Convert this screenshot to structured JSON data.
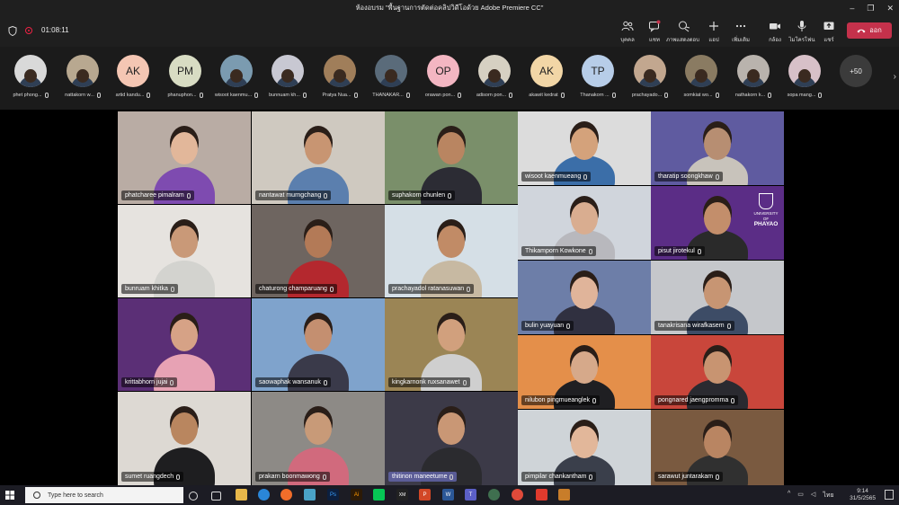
{
  "window": {
    "title": "ห้องอบรม \"พื้นฐานการตัดต่อคลิปวิดีโอด้วย Adobe Premiere CC\"",
    "controls": [
      "–",
      "❐",
      "✕"
    ]
  },
  "toolbar": {
    "timer": "01:08:11",
    "items": [
      {
        "label": "บุคคล",
        "icon": "people-icon"
      },
      {
        "label": "แชท",
        "icon": "chat-icon"
      },
      {
        "label": "ภาพแสดงตอบสนอง",
        "icon": "reactions-icon"
      },
      {
        "label": "แอป",
        "icon": "apps-icon"
      },
      {
        "label": "เพิ่มเติม",
        "icon": "more-icon"
      },
      {
        "label": "กล้อง",
        "icon": "camera-icon"
      },
      {
        "label": "ไมโครโฟน",
        "icon": "microphone-icon"
      },
      {
        "label": "แชร์",
        "icon": "share-icon"
      }
    ],
    "leave_label": "ออก"
  },
  "participants": [
    {
      "name": "phet phong...",
      "initials": "",
      "bg": "#d9d9d9"
    },
    {
      "name": "nattakorn w...",
      "initials": "",
      "bg": "#b8a890"
    },
    {
      "name": "artid kandu...",
      "initials": "AK",
      "bg": "#f4c6b3"
    },
    {
      "name": "phanuphon...",
      "initials": "PM",
      "bg": "#d8dcc3"
    },
    {
      "name": "wisoot kaenmu...",
      "initials": "",
      "bg": "#7b9bb0"
    },
    {
      "name": "bunnuam kh...",
      "initials": "",
      "bg": "#c8c8d2"
    },
    {
      "name": "Pratya Nua...",
      "initials": "",
      "bg": "#a07e5a"
    },
    {
      "name": "THANAKAR...",
      "initials": "",
      "bg": "#5a6b7a"
    },
    {
      "name": "orawan pon...",
      "initials": "OP",
      "bg": "#f3b6c2"
    },
    {
      "name": "adisorn pon...",
      "initials": "",
      "bg": "#d6d0c2"
    },
    {
      "name": "akawit kedrat",
      "initials": "AK",
      "bg": "#f2d6a6"
    },
    {
      "name": "Thanakorn ...",
      "initials": "TP",
      "bg": "#b7cde8"
    },
    {
      "name": "prachayado...",
      "initials": "",
      "bg": "#c2a78f"
    },
    {
      "name": "somkiat wo...",
      "initials": "",
      "bg": "#8a7b62"
    },
    {
      "name": "nathakorn k...",
      "initials": "",
      "bg": "#b9b3ad"
    },
    {
      "name": "sopa mang...",
      "initials": "",
      "bg": "#d7c0c8"
    }
  ],
  "more_count": "+50",
  "tiles": [
    {
      "name": "phatcharee pimalram",
      "bg": "#b9aca4",
      "skin": "#e2b79a",
      "shirt": "#7e4bb0"
    },
    {
      "name": "nantawat murngchang",
      "bg": "#cfc9c0",
      "skin": "#c89572",
      "shirt": "#5b7fae"
    },
    {
      "name": "suphakorn chunlen",
      "bg": "#7a8f6a",
      "skin": "#b98561",
      "shirt": "#2c2c34"
    },
    {
      "name": "wisoot kaenmueang",
      "bg": "#dcdcdc",
      "skin": "#d4a27b",
      "shirt": "#3b6ea8"
    },
    {
      "name": "tharatip soongkhaw",
      "bg": "#5f5ba0",
      "skin": "#b78e72",
      "shirt": "#c8c3bb"
    },
    {
      "name": "bunruam khitka",
      "bg": "#e6e3df",
      "skin": "#c99978",
      "shirt": "#d3d3cf"
    },
    {
      "name": "chaturong champaruang",
      "bg": "#6e6560",
      "skin": "#b37a57",
      "shirt": "#b4282e"
    },
    {
      "name": "prachayadol ratanasuwan",
      "bg": "#d5dfe6",
      "skin": "#c18b66",
      "shirt": "#c7b9a2"
    },
    {
      "name": "Thikamporn Kowkone",
      "bg": "#d0d5dc",
      "skin": "#d9ad90",
      "shirt": "#b8b8bd"
    },
    {
      "name": "pisut jirotekul",
      "bg": "#5b2d86",
      "skin": "#c38e6b",
      "shirt": "#2a2a2a"
    },
    {
      "name": "bulin yuayuan",
      "bg": "#6d7ea8",
      "skin": "#e0b49a",
      "shirt": "#303040"
    },
    {
      "name": "tanakrisana wirafkasem",
      "bg": "#c5c7cb",
      "skin": "#c79573",
      "shirt": "#3d4c66"
    },
    {
      "name": "krittabhorn jujai",
      "bg": "#5b2f76",
      "skin": "#d6a286",
      "shirt": "#e7a2b4"
    },
    {
      "name": "saowaphak wansanuk",
      "bg": "#7fa3cc",
      "skin": "#c48f70",
      "shirt": "#3a3a4a"
    },
    {
      "name": "kingkarnonk ruxsanawet",
      "bg": "#9b8555",
      "skin": "#d1a07d",
      "shirt": "#cfcfcf"
    },
    {
      "name": "nilubon pingmueanglek",
      "bg": "#e48f4a",
      "skin": "#d6a98a",
      "shirt": "#1f1f22"
    },
    {
      "name": "pongnared jaengpromma",
      "bg": "#c9463b",
      "skin": "#c89471",
      "shirt": "#2a2a30"
    },
    {
      "name": "sumet ruangdech",
      "bg": "#ddd9d3",
      "skin": "#b9865f",
      "shirt": "#1e1e20"
    },
    {
      "name": "prakarn boonmawong",
      "bg": "#8d8a86",
      "skin": "#c89a78",
      "shirt": "#d16a7d"
    },
    {
      "name": "thitinon maneetume",
      "bg": "#3c3a48",
      "skin": "#c99775",
      "shirt": "#2b2b2f"
    },
    {
      "name": "pimpilar chankantham",
      "bg": "#cfd4d8",
      "skin": "#e2b79a",
      "shirt": "#3a3f4b"
    },
    {
      "name": "sarawut juntarakam",
      "bg": "#7a5a40",
      "skin": "#b98562",
      "shirt": "#303030"
    }
  ],
  "logo_text": {
    "line1": "UNIVERSITY OF",
    "line2": "PHAYAO"
  },
  "taskbar": {
    "search_placeholder": "Type here to search",
    "time": "9:14",
    "date": "31/5/2565",
    "lang": "ไทย"
  }
}
